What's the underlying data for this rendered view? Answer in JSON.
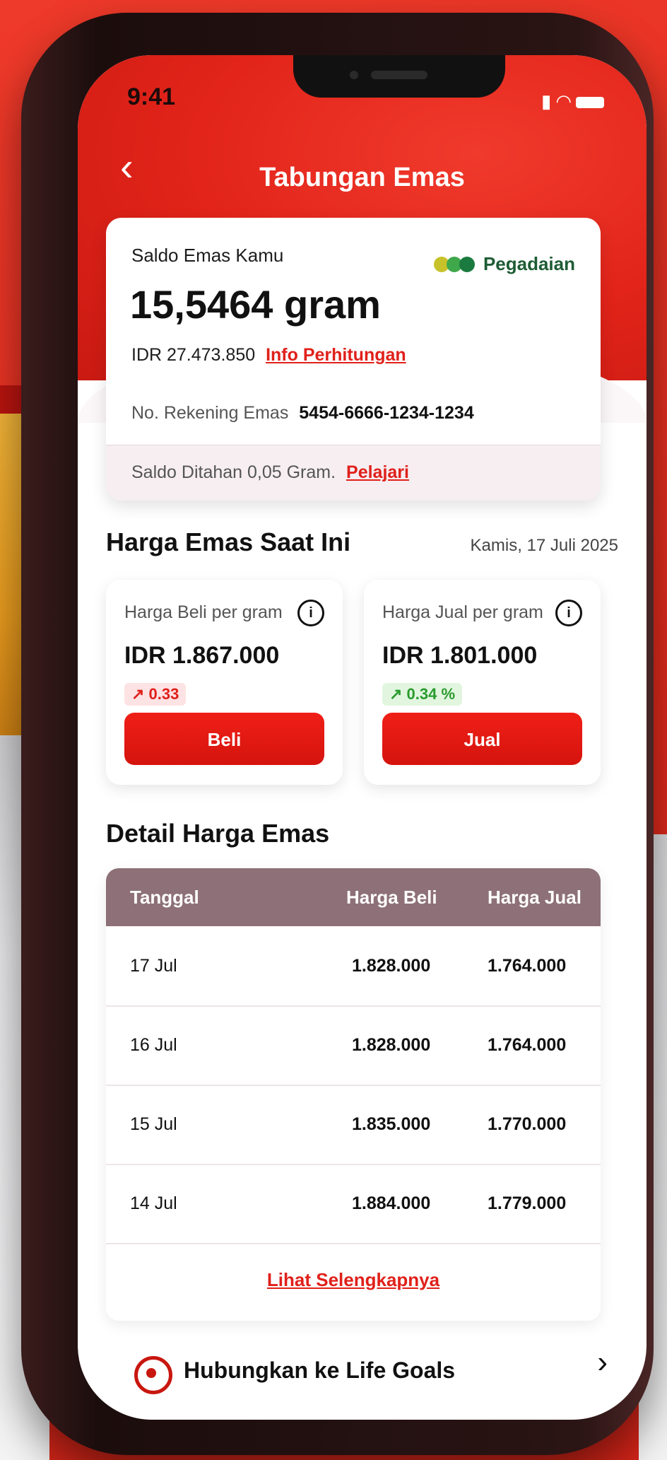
{
  "status_bar": {
    "time": "9:41"
  },
  "header": {
    "title": "Tabungan Emas"
  },
  "balance": {
    "label": "Saldo Emas Kamu",
    "amount": "15,5464 gram",
    "idr": "IDR 27.473.850",
    "info_link": "Info Perhitungan",
    "brand": "Pegadaian",
    "account_label": "No. Rekening Emas",
    "account_number": "5454-6666-1234-1234",
    "held_text": "Saldo Ditahan 0,05 Gram.",
    "held_link": "Pelajari"
  },
  "current_price": {
    "title": "Harga Emas Saat Ini",
    "date": "Kamis, 17 Juli 2025",
    "buy": {
      "label": "Harga Beli per gram",
      "price": "IDR 1.867.000",
      "change": "↗ 0.33",
      "button": "Beli"
    },
    "sell": {
      "label": "Harga Jual per gram",
      "price": "IDR 1.801.000",
      "change": "↗ 0.34 %",
      "button": "Jual"
    }
  },
  "detail": {
    "title": "Detail Harga Emas",
    "headers": {
      "date": "Tanggal",
      "buy": "Harga Beli",
      "sell": "Harga Jual"
    },
    "rows": [
      {
        "date": "17 Jul",
        "buy": "1.828.000",
        "sell": "1.764.000"
      },
      {
        "date": "16 Jul",
        "buy": "1.828.000",
        "sell": "1.764.000"
      },
      {
        "date": "15 Jul",
        "buy": "1.835.000",
        "sell": "1.770.000"
      },
      {
        "date": "14 Jul",
        "buy": "1.884.000",
        "sell": "1.779.000"
      }
    ],
    "more_link": "Lihat Selengkapnya"
  },
  "life_goals": {
    "label": "Hubungkan ke Life Goals"
  },
  "colors": {
    "brand_red": "#e0201a",
    "table_header": "#8d7078",
    "positive_green": "#2a9b2e"
  }
}
